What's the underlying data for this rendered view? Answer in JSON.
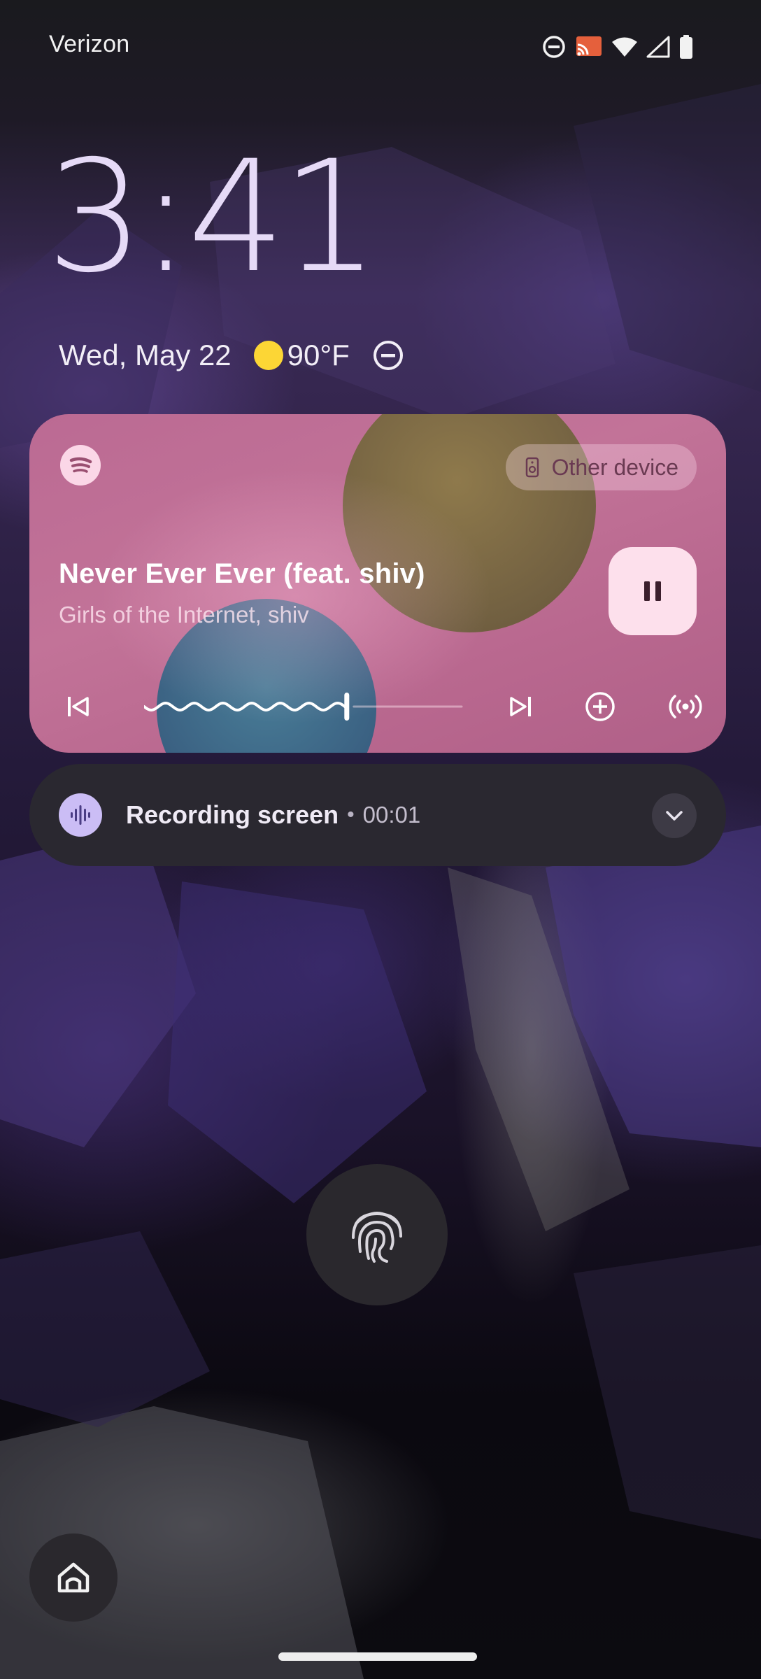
{
  "status_bar": {
    "carrier": "Verizon",
    "icons": [
      "do-not-disturb-icon",
      "cast-icon",
      "wifi-icon",
      "cellular-signal-icon",
      "battery-icon"
    ]
  },
  "lockscreen": {
    "time": "3:41",
    "date": "Wed, May 22",
    "weather_icon": "sun-icon",
    "temperature": "90°F",
    "dnd_icon": "do-not-disturb-icon"
  },
  "media_player": {
    "app_icon": "spotify-icon",
    "output_device": "Other device",
    "output_device_icon": "speaker-icon",
    "track_title": "Never Ever Ever (feat. shiv)",
    "track_artist": "Girls of the Internet, shiv",
    "playing": true,
    "progress": 0.63,
    "controls": [
      "previous-icon",
      "pause-icon",
      "next-icon",
      "add-icon",
      "broadcast-icon"
    ],
    "colors": {
      "card": "#bb6a93",
      "pause_button": "#fde0ec",
      "art_green": "#7a6c40",
      "art_blue": "#356a8a"
    }
  },
  "notification": {
    "icon": "sound-wave-icon",
    "title": "Recording screen",
    "separator": "•",
    "elapsed": "00:01",
    "expand_icon": "chevron-down-icon"
  },
  "unlock": {
    "icon": "fingerprint-icon"
  },
  "shortcut": {
    "icon": "home-icon"
  }
}
